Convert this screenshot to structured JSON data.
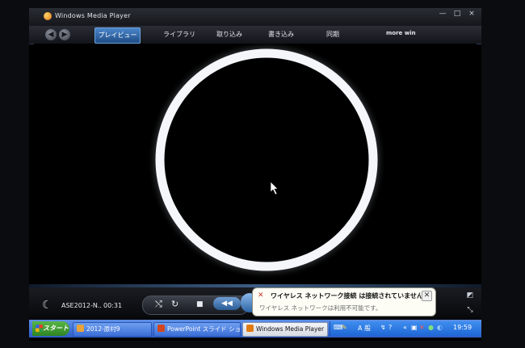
{
  "window": {
    "title": "Windows Media Player",
    "min_label": "—",
    "max_label": "□",
    "close_label": "×"
  },
  "nav": {
    "back_label": "◀",
    "forward_label": "▶",
    "tabs": [
      {
        "label": "プレイビュー",
        "active": true
      },
      {
        "label": "ライブラリ"
      },
      {
        "label": "取り込み"
      },
      {
        "label": "書き込み"
      },
      {
        "label": "同期"
      },
      {
        "label": "more win"
      }
    ]
  },
  "player": {
    "media_name": "ASE2012-N..",
    "elapsed": "00:31",
    "shuffle_label": "⤭",
    "repeat_label": "↻",
    "stop_label": "■",
    "prev_label": "◀◀"
  },
  "notification": {
    "title": "ワイヤレス ネットワーク接続 は接続されていません。",
    "body": "ワイヤレス ネットワークは利用不可能です。",
    "close_label": "✕"
  },
  "taskbar": {
    "start_label": "スタート",
    "tasks": [
      {
        "label": "2012-原村9"
      },
      {
        "label": "PowerPoint スライド ショ..."
      },
      {
        "label": "Windows Media Player",
        "active": true
      }
    ],
    "tray": {
      "ime_label": "A 般",
      "clock": "19:59"
    }
  },
  "colors": {
    "accent": "#2d64b0",
    "taskbar": "#2d5ec8",
    "start": "#3a9a2c",
    "eclipse_ring": "#ffffff"
  }
}
